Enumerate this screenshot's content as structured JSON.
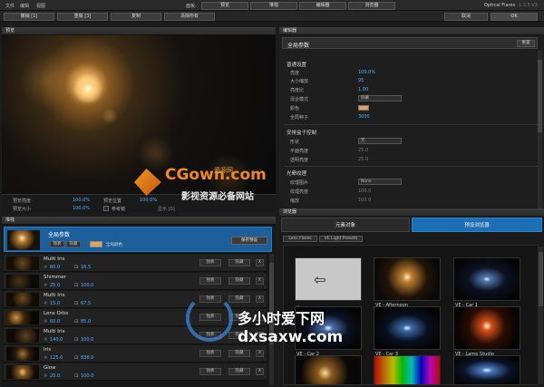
{
  "menu": {
    "file": "文件",
    "edit": "编辑",
    "view": "视图",
    "mode_label": "面板:"
  },
  "top_tabs": [
    "预览",
    "堆栈",
    "编辑器",
    "浏览器"
  ],
  "app_title": "Optical Flares",
  "version": "1.3.5 V3",
  "toolbar": {
    "btn1": "撤销 [1]",
    "btn2": "重做 [3]",
    "btn3": "复制",
    "btn4": "清除所有",
    "cancel": "取消",
    "ok": "OK"
  },
  "preview": {
    "header": "预览",
    "stats": [
      {
        "label": "预览亮度",
        "value": "100.0%"
      },
      {
        "label": "预览大小",
        "value": "100.0%"
      },
      {
        "label": "预览位置",
        "value": "100.0%"
      }
    ],
    "ref_label": "参考镜",
    "extra_label": "显示 [0]"
  },
  "editor": {
    "header": "编辑器",
    "title": "全局参数",
    "title_btn": "重置",
    "sections": [
      {
        "title": "普通设置",
        "rows": [
          {
            "label": "亮度",
            "value": "100.0%"
          },
          {
            "label": "大小缩放",
            "value": "95"
          },
          {
            "label": "亮度比",
            "value": "1.00"
          },
          {
            "label": "混合模式",
            "value": "屏幕"
          },
          {
            "label": "颜色",
            "value": ""
          },
          {
            "label": "全局种子",
            "value": "3000"
          }
        ]
      },
      {
        "title": "安排盒子控制",
        "rows": [
          {
            "label": "形状",
            "value": "无"
          },
          {
            "label": "平面亮度",
            "value": "25.0"
          },
          {
            "label": "透明亮度",
            "value": "25.0"
          }
        ]
      },
      {
        "title": "光晕纹理",
        "rows": [
          {
            "label": "纹理图片",
            "value": "None"
          },
          {
            "label": "纹理亮度",
            "value": "100.0"
          },
          {
            "label": "缩放",
            "value": "100.0"
          }
        ]
      }
    ],
    "color_swatch": "#e0a060"
  },
  "stack": {
    "header": "堆栈",
    "global": {
      "title": "全局参数",
      "btn_a": "独奏",
      "btn_b": "隐藏",
      "color_label": "全局颜色",
      "save_btn": "保存预设"
    },
    "items": [
      {
        "name": "Multi Iris",
        "v1": "80.0",
        "v2": "16.5"
      },
      {
        "name": "Shimmer",
        "v1": "25.0",
        "v2": "100.0"
      },
      {
        "name": "Multi Iris",
        "v1": "15.0",
        "v2": "67.5"
      },
      {
        "name": "Lens Orbs",
        "v1": "60.0",
        "v2": "85.0"
      },
      {
        "name": "Multi Iris",
        "v1": "140.0",
        "v2": "100.0"
      },
      {
        "name": "Iris",
        "v1": "125.0",
        "v2": "838.0"
      },
      {
        "name": "Glow",
        "v1": "20.0",
        "v2": "100.0"
      }
    ],
    "btn_solo": "独奏",
    "btn_hide": "隐藏",
    "btn_x": "X"
  },
  "browser": {
    "header": "浏览器",
    "tab_left": "元素对象",
    "tab_right": "预设浏览器",
    "path": [
      "Lens Flares",
      "VE Light Presets"
    ],
    "tiles": [
      "..",
      "VE - Afternoon",
      "VE - Car 1",
      "VE - Car 2",
      "VE - Car 3",
      "VE - Lamp Studio",
      "",
      "",
      ""
    ]
  },
  "watermark": {
    "cg_text": "CGown.com",
    "cg_top": "资源网",
    "cg_sub": "影视资源必备网站",
    "site_cn": "多小时爱下网",
    "site_url": "dxsaxw.com"
  },
  "colors": {
    "accent": "#1c6fb4",
    "value": "#55b0ff",
    "watermark": "#f08a1e"
  }
}
